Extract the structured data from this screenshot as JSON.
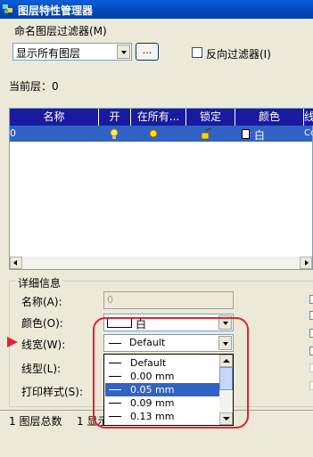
{
  "window": {
    "title": "图层特性管理器"
  },
  "filter": {
    "group_label": "命名图层过滤器(M)",
    "selected": "显示所有图层",
    "browse_label": "...",
    "invert_label": "反向过滤器(I)"
  },
  "current_layer": "当前层：0",
  "table": {
    "columns": [
      "名称",
      "开",
      "在所有...",
      "锁定",
      "颜色",
      "线"
    ],
    "rows": [
      {
        "name": "0",
        "color": "白",
        "linetype": "Co"
      }
    ]
  },
  "details": {
    "group_label": "详细信息",
    "name_label": "名称(A):",
    "name_value": "0",
    "color_label": "颜色(O):",
    "color_value": "白",
    "lineweight_label": "线宽(W):",
    "lineweight_value": "Default",
    "linetype_label": "线型(L):",
    "plotstyle_label": "打印样式(S):"
  },
  "lineweight_options": [
    "Default",
    "0.00 mm",
    "0.05 mm",
    "0.09 mm",
    "0.13 mm"
  ],
  "lineweight_highlighted": "0.05 mm",
  "status": {
    "total": "1 图层总数",
    "shown": "1 显示"
  },
  "colors": {
    "titlebar": "#0047b8",
    "selection": "#3162c5",
    "header": "#1a1aa0",
    "annotation": "#e0242c"
  }
}
